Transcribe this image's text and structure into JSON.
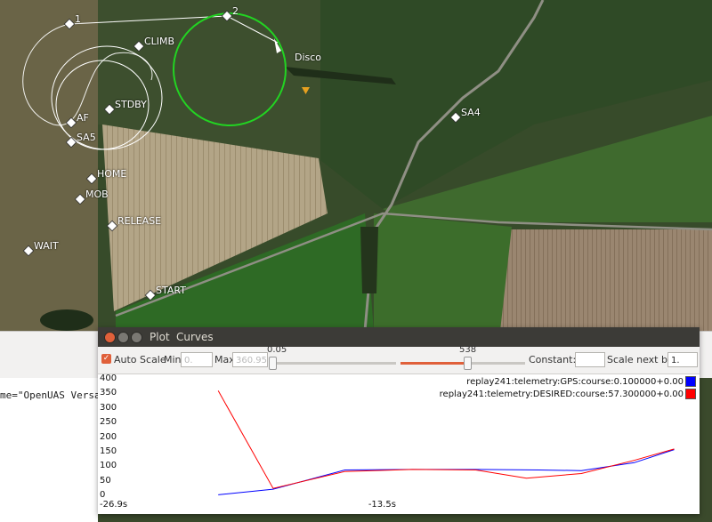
{
  "waypoints": [
    {
      "id": "wp1",
      "label": "1"
    },
    {
      "id": "wp2",
      "label": "2"
    },
    {
      "id": "climb",
      "label": "CLIMB"
    },
    {
      "id": "stdby",
      "label": "STDBY"
    },
    {
      "id": "af",
      "label": "AF"
    },
    {
      "id": "sa5",
      "label": "SA5"
    },
    {
      "id": "home",
      "label": "HOME"
    },
    {
      "id": "mob",
      "label": "MOB"
    },
    {
      "id": "release",
      "label": "RELEASE"
    },
    {
      "id": "wait",
      "label": "WAIT"
    },
    {
      "id": "start",
      "label": "START"
    },
    {
      "id": "sa4",
      "label": "SA4"
    }
  ],
  "aircraft_label": "Disco",
  "background_text": "me=\"OpenUAS Versat",
  "plot_window": {
    "title": "Plot",
    "menu_curves": "Curves",
    "auto_scale_label": "Auto Scale",
    "auto_scale_checked": true,
    "min_label": "Min",
    "min_value": "0.",
    "max_label": "Max",
    "max_value": "360.95",
    "slider1_value": "0.05",
    "slider2_value": "538",
    "constant_label": "Constant:",
    "constant_value": "",
    "scale_next_label": "Scale next by",
    "scale_next_value": "1."
  },
  "chart_data": {
    "type": "line",
    "ylim": [
      0,
      400
    ],
    "yticks": [
      "400",
      "350",
      "300",
      "250",
      "200",
      "150",
      "100",
      "50",
      "0"
    ],
    "xticks": [
      "-26.9s",
      "-13.5s"
    ],
    "series": [
      {
        "name": "replay241:telemetry:GPS:course:0.100000+0.00",
        "color": "#0000ff",
        "x": [
          -21.2,
          -18.6,
          -15.2,
          -12.0,
          -9.0,
          -6.0,
          -4.0,
          -1.5,
          0.4
        ],
        "y": [
          5,
          24,
          90,
          92,
          92,
          90,
          88,
          115,
          160
        ]
      },
      {
        "name": "replay241:telemetry:DESIRED:course:57.300000+0.00",
        "color": "#ff0000",
        "x": [
          -21.2,
          -18.6,
          -15.2,
          -12.0,
          -9.0,
          -6.6,
          -4.0,
          -1.5,
          0.4
        ],
        "y": [
          362,
          27,
          85,
          92,
          90,
          62,
          78,
          123,
          162
        ]
      }
    ]
  }
}
